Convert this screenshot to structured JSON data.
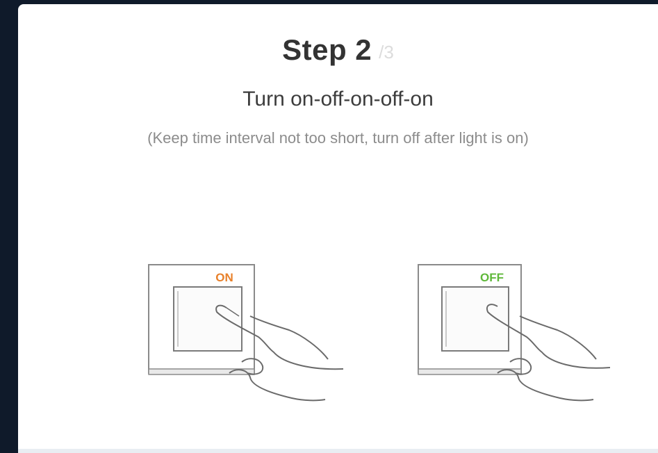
{
  "step": {
    "title": "Step 2",
    "total": "/3"
  },
  "instruction": "Turn on-off-on-off-on",
  "hint": "(Keep time interval not too short, turn off after light is on)",
  "switches": [
    {
      "label": "ON",
      "color": "#e8802a",
      "icon": "light-switch-on-icon"
    },
    {
      "label": "OFF",
      "color": "#5fb83a",
      "icon": "light-switch-off-icon"
    }
  ],
  "colors": {
    "background": "#0f1a2a",
    "card": "#ffffff",
    "title": "#333333",
    "hint": "#8c8c8c"
  }
}
